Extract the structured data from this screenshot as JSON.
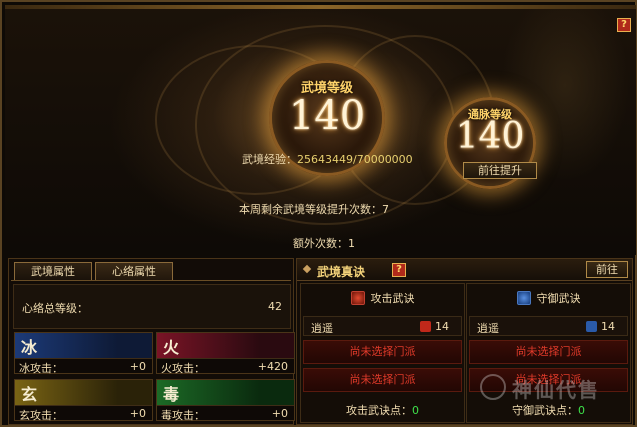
{
  "top": {
    "help_label": "?",
    "realm_label": "武境等级",
    "realm_level": "140",
    "meridian_label": "通脉等级",
    "meridian_level": "140",
    "exp_label": "武境经验：",
    "exp_value": "25643449/70000000",
    "upgrade_button": "前往提升",
    "weekly_text": "本周剩余武境等级提升次数：7",
    "extra_text": "额外次数：1"
  },
  "left_panel": {
    "tabs": [
      {
        "label": "武境属性"
      },
      {
        "label": "心络属性"
      }
    ],
    "total_label": "心络总等级：",
    "total_value": "42",
    "elements": [
      {
        "glyph": "冰",
        "label": "冰攻击：",
        "value": "+0",
        "color": "#1c3a78"
      },
      {
        "glyph": "火",
        "label": "火攻击：",
        "value": "+420",
        "color": "#7a1426"
      },
      {
        "glyph": "玄",
        "label": "玄攻击：",
        "value": "+0",
        "color": "#7a6414"
      },
      {
        "glyph": "毒",
        "label": "毒攻击：",
        "value": "+0",
        "color": "#1c6a26"
      }
    ]
  },
  "right_panel": {
    "title": "武境真诀",
    "help_label": "?",
    "goto_button": "前往",
    "attack": {
      "title": "攻击武诀",
      "icon": "attack-emblem-icon",
      "slot_name": "逍遥",
      "slot_value": "14",
      "empty1": "尚未选择门派",
      "empty2": "尚未选择门派",
      "points_label": "攻击武诀点：",
      "points_value": "0"
    },
    "defense": {
      "title": "守御武诀",
      "icon": "defense-emblem-icon",
      "slot_name": "逍遥",
      "slot_value": "14",
      "empty1": "尚未选择门派",
      "empty2": "尚未选择门派",
      "points_label": "守御武诀点：",
      "points_value": "0"
    }
  },
  "watermark": {
    "text": "神仙代售"
  }
}
